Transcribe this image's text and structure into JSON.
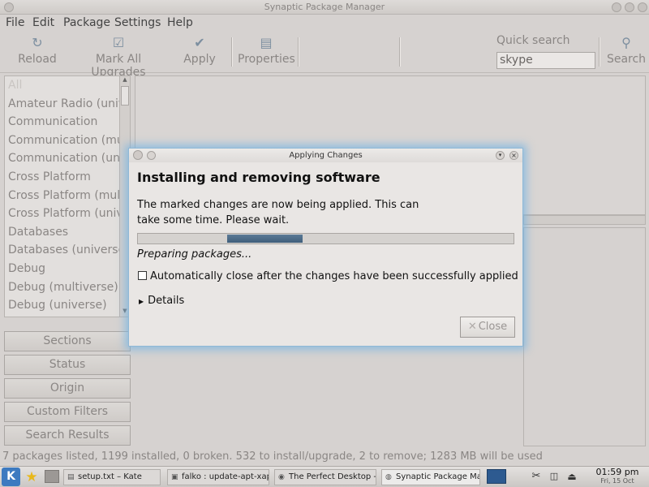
{
  "window": {
    "title": "Synaptic Package Manager"
  },
  "menu": [
    "File",
    "Edit",
    "Package",
    "Settings",
    "Help"
  ],
  "toolbar": {
    "reload": "Reload",
    "mark_all": "Mark All Upgrades",
    "apply": "Apply",
    "properties": "Properties",
    "quick_search_label": "Quick search",
    "quick_search_value": "skype",
    "search": "Search"
  },
  "sections": [
    "All",
    "Amateur Radio (univ",
    "Communication",
    "Communication (mu",
    "Communication (uni",
    "Cross Platform",
    "Cross Platform (mult",
    "Cross Platform (univ",
    "Databases",
    "Databases (universe)",
    "Debug",
    "Debug (multiverse)",
    "Debug (universe)"
  ],
  "filter_buttons": {
    "sections": "Sections",
    "status": "Status",
    "origin": "Origin",
    "custom_filters": "Custom Filters",
    "search_results": "Search Results"
  },
  "status_bar": "7 packages listed, 1199 installed, 0 broken. 532 to install/upgrade, 2 to remove; 1283 MB will be used",
  "dialog": {
    "title": "Applying Changes",
    "heading": "Installing and removing software",
    "message": "The marked changes are now being applied. This can take some time. Please wait.",
    "progress_label": "Preparing packages...",
    "autoclose": "Automatically close after the changes have been successfully applied",
    "details": "Details",
    "close_label": "Close"
  },
  "taskbar": {
    "tasks": [
      "setup.txt – Kate",
      "falko : update-apt-xapi",
      "The Perfect Desktop -",
      "Synaptic Package Mana"
    ],
    "time": "01:59 pm",
    "date": "Fri, 15 Oct"
  },
  "colors": {
    "accent": "#4a6b8a",
    "glow": "#78b4e1"
  }
}
